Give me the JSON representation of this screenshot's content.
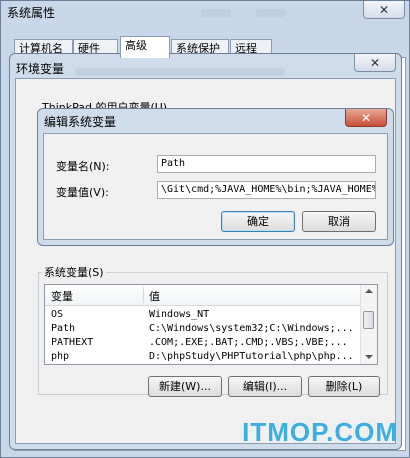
{
  "system_properties": {
    "title": "系统属性",
    "tabs": [
      "计算机名",
      "硬件",
      "高级",
      "系统保护",
      "远程"
    ],
    "active_tab": 2,
    "ok_label": "确定",
    "cancel_label": "取消",
    "close_glyph": "✕"
  },
  "env_vars": {
    "title": "环境变量",
    "user_section_label": "ThinkPad 的用户变量(U)",
    "system_section_label": "系统变量(S)",
    "columns": [
      "变量",
      "值"
    ],
    "system_vars": [
      {
        "name": "OS",
        "value": "Windows_NT"
      },
      {
        "name": "Path",
        "value": "C:\\Windows\\system32;C:\\Windows;..."
      },
      {
        "name": "PATHEXT",
        "value": ".COM;.EXE;.BAT;.CMD;.VBS;.VBE;..."
      },
      {
        "name": "php",
        "value": "D:\\phpStudy\\PHPTutorial\\php\\php..."
      }
    ],
    "new_label": "新建(W)...",
    "edit_label": "编辑(I)...",
    "delete_label": "删除(L)",
    "close_glyph": "✕"
  },
  "edit_dialog": {
    "title": "编辑系统变量",
    "name_label": "变量名(N):",
    "name_value": "Path",
    "value_label": "变量值(V):",
    "value_value": "\\Git\\cmd;%JAVA_HOME%\\bin;%JAVA_HOME%",
    "ok_label": "确定",
    "cancel_label": "取消",
    "close_glyph": "✕"
  },
  "watermark": "ITMOP.COM"
}
